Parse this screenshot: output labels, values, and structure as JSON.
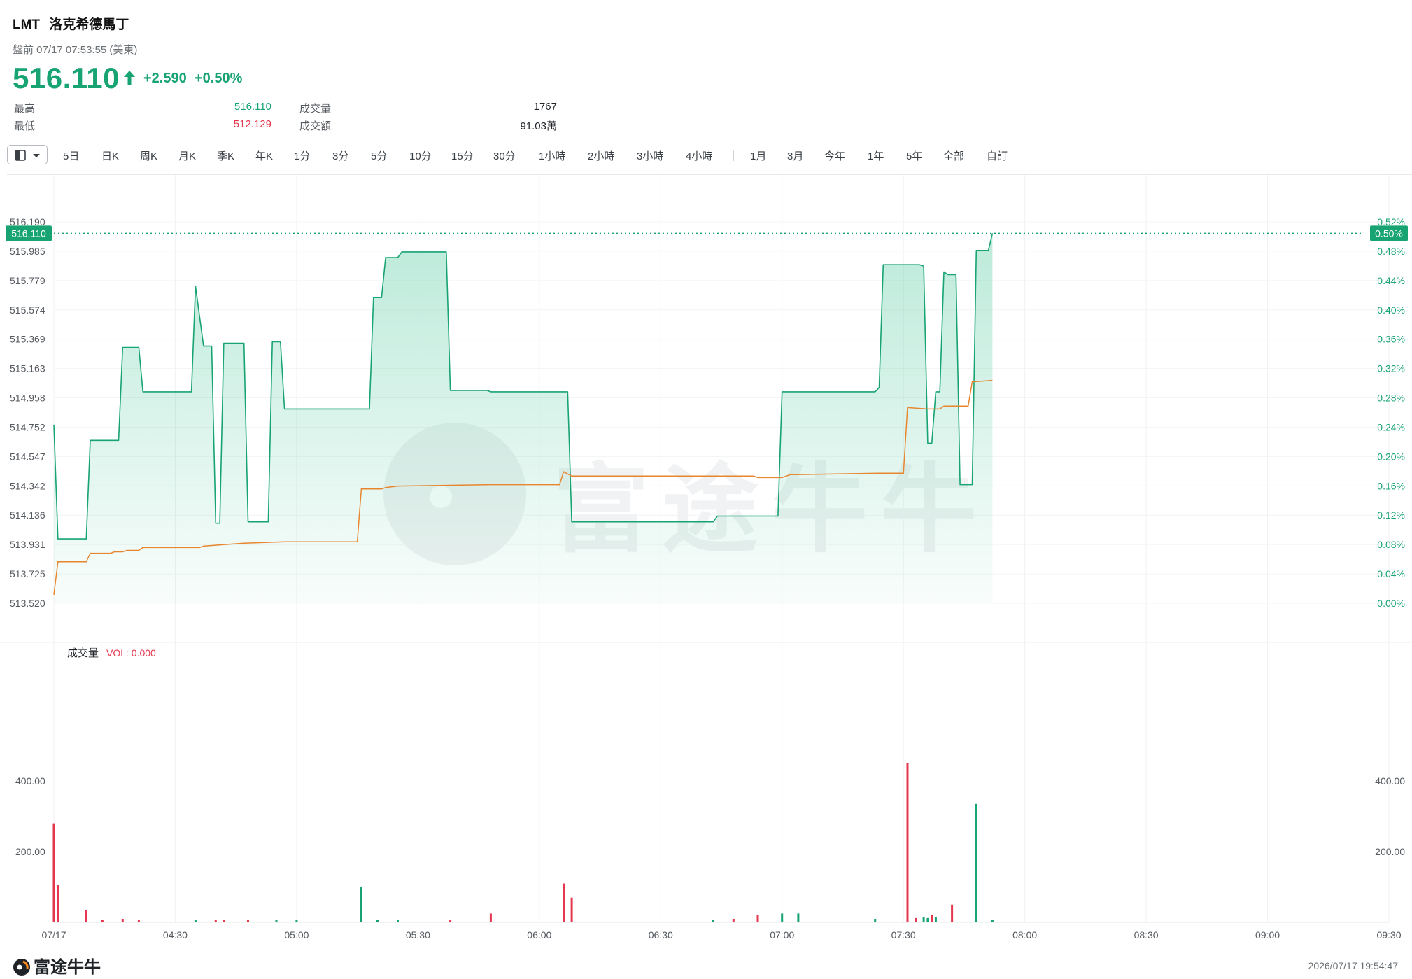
{
  "header": {
    "ticker": "LMT",
    "name": "洛克希德馬丁",
    "session": "盤前 07/17 07:53:55 (美東)",
    "price": "516.110",
    "change": "+2.590",
    "change_pct": "+0.50%",
    "arrow_icon": "up-arrow-icon"
  },
  "stats": {
    "high_label": "最高",
    "high_value": "516.110",
    "low_label": "最低",
    "low_value": "512.129",
    "volume_label": "成交量",
    "volume_value": "1767",
    "turnover_label": "成交額",
    "turnover_value": "91.03萬"
  },
  "toolbar": {
    "items_a": [
      "5日",
      "日K",
      "周K",
      "月K",
      "季K",
      "年K",
      "1分",
      "3分",
      "5分",
      "10分",
      "15分",
      "30分",
      "1小時",
      "2小時",
      "3小時",
      "4小時"
    ],
    "items_b": [
      "1月",
      "3月",
      "今年",
      "1年",
      "5年",
      "全部",
      "自訂"
    ],
    "toggle_icon": "panel-toggle-icon"
  },
  "colors": {
    "up": "#17a372",
    "down": "#e5384f",
    "avg_line": "#e8862f",
    "area_fill": "#2dbf8a"
  },
  "chart_data": [
    {
      "type": "area",
      "title": "",
      "x_ticks": [
        "07/17",
        "04:30",
        "05:00",
        "05:30",
        "06:00",
        "06:30",
        "07:00",
        "07:30",
        "08:00",
        "08:30",
        "09:00",
        "09:30"
      ],
      "y_ticks": [
        "516.190",
        "515.985",
        "515.779",
        "515.574",
        "515.369",
        "515.163",
        "514.958",
        "514.752",
        "514.547",
        "514.342",
        "514.136",
        "513.931",
        "513.725",
        "513.520"
      ],
      "y_ticks_right": [
        "0.52%",
        "0.48%",
        "0.44%",
        "0.40%",
        "0.36%",
        "0.32%",
        "0.28%",
        "0.24%",
        "0.20%",
        "0.16%",
        "0.12%",
        "0.08%",
        "0.04%",
        "0.00%"
      ],
      "ylim": [
        513.52,
        516.19
      ],
      "current_price_label": "516.110",
      "current_pct_label": "0.50%",
      "watermark": "富途牛牛",
      "series": [
        {
          "name": "price",
          "points": [
            [
              "04:00",
              514.77
            ],
            [
              "04:01",
              513.97
            ],
            [
              "04:08",
              513.97
            ],
            [
              "04:09",
              514.66
            ],
            [
              "04:16",
              514.66
            ],
            [
              "04:17",
              515.31
            ],
            [
              "04:21",
              515.31
            ],
            [
              "04:22",
              515.0
            ],
            [
              "04:34",
              515.0
            ],
            [
              "04:35",
              515.74
            ],
            [
              "04:37",
              515.32
            ],
            [
              "04:39",
              515.32
            ],
            [
              "04:40",
              514.08
            ],
            [
              "04:41",
              514.08
            ],
            [
              "04:42",
              515.34
            ],
            [
              "04:47",
              515.34
            ],
            [
              "04:48",
              514.09
            ],
            [
              "04:53",
              514.09
            ],
            [
              "04:54",
              515.35
            ],
            [
              "04:56",
              515.35
            ],
            [
              "04:57",
              514.88
            ],
            [
              "05:18",
              514.88
            ],
            [
              "05:19",
              515.66
            ],
            [
              "05:21",
              515.66
            ],
            [
              "05:22",
              515.94
            ],
            [
              "05:25",
              515.94
            ],
            [
              "05:26",
              515.98
            ],
            [
              "05:37",
              515.98
            ],
            [
              "05:38",
              515.01
            ],
            [
              "05:47",
              515.01
            ],
            [
              "05:48",
              515.0
            ],
            [
              "06:07",
              515.0
            ],
            [
              "06:08",
              514.09
            ],
            [
              "06:43",
              514.09
            ],
            [
              "06:44",
              514.13
            ],
            [
              "06:59",
              514.13
            ],
            [
              "07:00",
              515.0
            ],
            [
              "07:23",
              515.0
            ],
            [
              "07:24",
              515.03
            ],
            [
              "07:25",
              515.89
            ],
            [
              "07:34",
              515.89
            ],
            [
              "07:35",
              515.88
            ],
            [
              "07:36",
              514.64
            ],
            [
              "07:37",
              514.64
            ],
            [
              "07:38",
              515.0
            ],
            [
              "07:39",
              515.0
            ],
            [
              "07:40",
              515.84
            ],
            [
              "07:41",
              515.82
            ],
            [
              "07:43",
              515.82
            ],
            [
              "07:44",
              514.35
            ],
            [
              "07:47",
              514.35
            ],
            [
              "07:48",
              515.99
            ],
            [
              "07:51",
              515.99
            ],
            [
              "07:52",
              516.11
            ]
          ]
        },
        {
          "name": "average",
          "points": [
            [
              "04:00",
              513.58
            ],
            [
              "04:01",
              513.81
            ],
            [
              "04:08",
              513.81
            ],
            [
              "04:09",
              513.87
            ],
            [
              "04:14",
              513.87
            ],
            [
              "04:15",
              513.88
            ],
            [
              "04:17",
              513.88
            ],
            [
              "04:18",
              513.89
            ],
            [
              "04:21",
              513.89
            ],
            [
              "04:22",
              513.91
            ],
            [
              "04:36",
              513.91
            ],
            [
              "04:37",
              513.92
            ],
            [
              "04:42",
              513.93
            ],
            [
              "04:47",
              513.94
            ],
            [
              "04:57",
              513.95
            ],
            [
              "05:15",
              513.95
            ],
            [
              "05:16",
              514.32
            ],
            [
              "05:21",
              514.32
            ],
            [
              "05:22",
              514.33
            ],
            [
              "05:25",
              514.34
            ],
            [
              "05:48",
              514.35
            ],
            [
              "06:05",
              514.35
            ],
            [
              "06:06",
              514.44
            ],
            [
              "06:08",
              514.41
            ],
            [
              "06:48",
              514.41
            ],
            [
              "06:49",
              514.41
            ],
            [
              "06:53",
              514.41
            ],
            [
              "06:54",
              514.4
            ],
            [
              "07:00",
              514.4
            ],
            [
              "07:02",
              514.42
            ],
            [
              "07:24",
              514.43
            ],
            [
              "07:30",
              514.43
            ],
            [
              "07:31",
              514.89
            ],
            [
              "07:36",
              514.88
            ],
            [
              "07:39",
              514.88
            ],
            [
              "07:40",
              514.9
            ],
            [
              "07:46",
              514.9
            ],
            [
              "07:47",
              515.07
            ],
            [
              "07:52",
              515.08
            ]
          ]
        }
      ]
    },
    {
      "type": "bar",
      "title": "成交量",
      "indicator": "VOL: 0.000",
      "y_ticks": [
        "400.00",
        "200.00"
      ],
      "ylim": [
        0,
        520
      ],
      "series": [
        {
          "name": "成交量",
          "bars": [
            [
              "04:00",
              280,
              "down"
            ],
            [
              "04:01",
              105,
              "down"
            ],
            [
              "04:08",
              35,
              "down"
            ],
            [
              "04:12",
              8,
              "down"
            ],
            [
              "04:17",
              10,
              "down"
            ],
            [
              "04:21",
              8,
              "down"
            ],
            [
              "04:35",
              8,
              "up"
            ],
            [
              "04:40",
              6,
              "down"
            ],
            [
              "04:42",
              8,
              "down"
            ],
            [
              "04:48",
              6,
              "down"
            ],
            [
              "04:55",
              6,
              "up"
            ],
            [
              "05:00",
              6,
              "up"
            ],
            [
              "05:16",
              100,
              "up"
            ],
            [
              "05:20",
              8,
              "up"
            ],
            [
              "05:25",
              6,
              "up"
            ],
            [
              "05:38",
              8,
              "down"
            ],
            [
              "05:48",
              25,
              "down"
            ],
            [
              "06:06",
              110,
              "down"
            ],
            [
              "06:08",
              70,
              "down"
            ],
            [
              "06:43",
              6,
              "up"
            ],
            [
              "06:48",
              10,
              "down"
            ],
            [
              "06:54",
              20,
              "down"
            ],
            [
              "07:00",
              25,
              "up"
            ],
            [
              "07:04",
              25,
              "up"
            ],
            [
              "07:23",
              10,
              "up"
            ],
            [
              "07:31",
              450,
              "down"
            ],
            [
              "07:33",
              12,
              "down"
            ],
            [
              "07:35",
              15,
              "up"
            ],
            [
              "07:36",
              12,
              "up"
            ],
            [
              "07:37",
              20,
              "down"
            ],
            [
              "07:38",
              15,
              "up"
            ],
            [
              "07:42",
              50,
              "down"
            ],
            [
              "07:48",
              335,
              "up"
            ],
            [
              "07:52",
              8,
              "up"
            ]
          ]
        }
      ]
    }
  ],
  "footer": {
    "logo": "富途牛牛",
    "timestamp": "2026/07/17 19:54:47"
  }
}
